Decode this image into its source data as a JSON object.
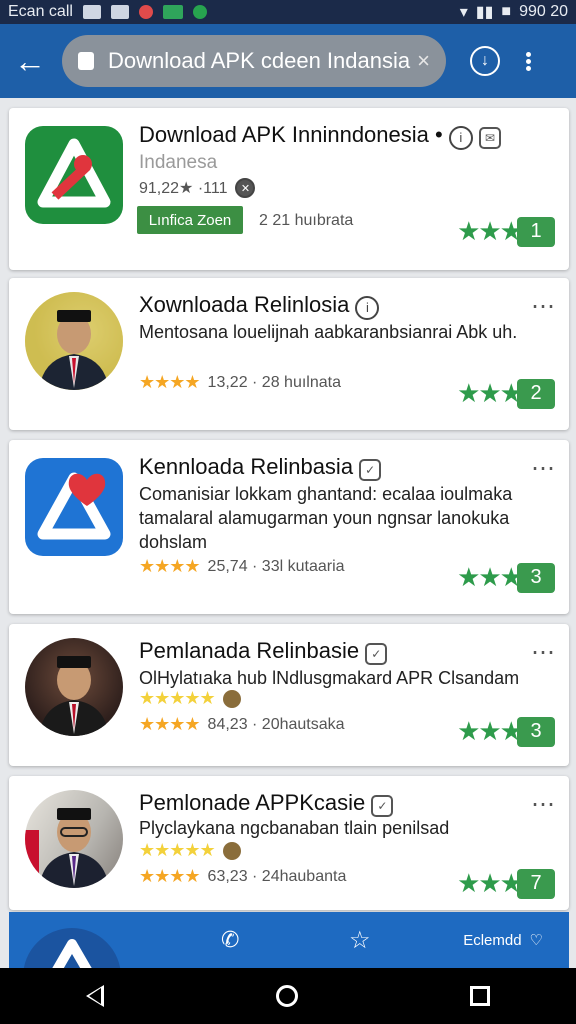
{
  "status_bar": {
    "carrier": "Ecan call",
    "clock": "990 20"
  },
  "browser": {
    "url": "Download APK cdeen Indansia",
    "clear_glyph": "×",
    "back_glyph": "←",
    "download_glyph": "↓"
  },
  "results": [
    {
      "title": "Download APK Inninndonesia",
      "title_dot": "•",
      "subtitle": "Indanesa",
      "meta": "91,22★ ·111",
      "install_label": "Lınfica Zoen",
      "reviews": "2 21 huıbrata",
      "badge": "1"
    },
    {
      "title": "Xownloada Relinlosia",
      "desc": "Mentosana louelijnah aabkaranbsianrai Abk uh.",
      "meta": "13,22 · 28 huılnata",
      "badge": "2"
    },
    {
      "title": "Kennloada Relinbasia",
      "desc": "Comanisiar lokkam ghantand: ecalaa ioulmaka tamalaral alamugarman youn ngnsar lanokuka dohslam",
      "meta": "25,74 · 33l kutaaria",
      "badge": "3"
    },
    {
      "title": "Pemlanada Relinbasie",
      "desc": "OlHylatıaka hub lNdlusgmakard APR Clsandam",
      "meta": "84,23 · 20hautsaka",
      "badge": "3"
    },
    {
      "title": "Pemlonade APPKcasie",
      "desc": "Plyclaykana ngcbanaban tlain penilsad",
      "meta": "63,23 · 24haubanta",
      "badge": "7"
    }
  ],
  "bottom_bar": {
    "fav_label": "Eclemdd"
  },
  "colors": {
    "appbar": "#1e5fa8",
    "statusbar": "#1b2a49",
    "green": "#3a9a4e",
    "star_orange": "#f5a623"
  }
}
